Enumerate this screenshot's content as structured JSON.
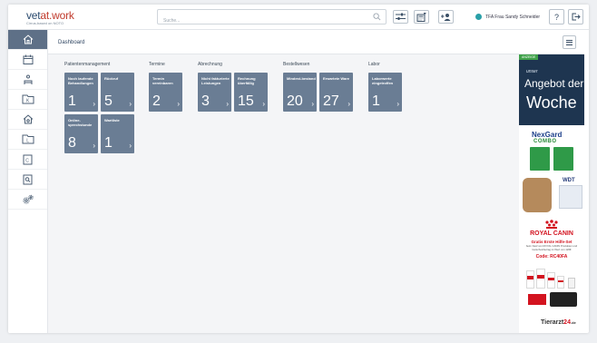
{
  "app": {
    "logo_brand_1": "vet",
    "logo_brand_2": "at.work",
    "logo_tagline": "Cirrus-based on NOTO"
  },
  "search": {
    "placeholder": "Suche..."
  },
  "user": {
    "name": "TFA Frau Sandy Schneider",
    "status_color": "#2aa0a8"
  },
  "header": {
    "title": "Dashboard"
  },
  "sidebar": {
    "items": [
      {
        "icon": "home-icon"
      },
      {
        "icon": "calendar-icon"
      },
      {
        "icon": "waiting-room-icon"
      },
      {
        "icon": "patient-folder-k-icon"
      },
      {
        "icon": "house-visit-icon"
      },
      {
        "icon": "folder-l-icon"
      },
      {
        "icon": "document-c-icon"
      },
      {
        "icon": "document-search-icon"
      },
      {
        "icon": "settings-gears-icon"
      }
    ]
  },
  "groups": [
    {
      "title": "Patientenmanagement",
      "tiles": [
        {
          "label": "Noch laufende Behandlungen",
          "count": "1"
        },
        {
          "label": "Rückruf",
          "count": "5"
        },
        {
          "label": "Online-sprechstunde",
          "count": "8"
        },
        {
          "label": "Wartliste",
          "count": "1"
        }
      ]
    },
    {
      "title": "Termine",
      "tiles": [
        {
          "label": "Termin vereinbaren",
          "count": "2"
        }
      ]
    },
    {
      "title": "Abrechnung",
      "tiles": [
        {
          "label": "Nicht fakturierte Leistungen",
          "count": "3"
        },
        {
          "label": "Rechnung überfällig",
          "count": "15"
        }
      ]
    },
    {
      "title": "Bestellwesen",
      "tiles": [
        {
          "label": "Mindest-bestand",
          "count": "20"
        },
        {
          "label": "Erwartete Ware",
          "count": "27"
        }
      ]
    },
    {
      "title": "Labor",
      "tiles": [
        {
          "label": "Laborwerte eingetroffen",
          "count": "1"
        }
      ]
    }
  ],
  "ads": {
    "ad1": {
      "badge": "ANZEIGE",
      "line1": "unser",
      "line2": "Angebot der",
      "line3": "Woche"
    },
    "nexgard": {
      "brand": "NexGard",
      "sub": "COMBO"
    },
    "wdt": {
      "logo": "WDT"
    },
    "royalcanin": {
      "logo": "ROYAL CANIN",
      "line1": "Gratis Erste Hilfe-Set",
      "line2": "beim Kauf von ROYAL CANIN Produkten und Gutscheinbetrag im Wert von 120€",
      "code": "Code: RC40FA"
    },
    "tierarzt24": {
      "logo_1": "Tierarzt",
      "logo_2": "24",
      "logo_3": ".de"
    }
  },
  "colors": {
    "tile": "#6a7d94",
    "sidebar_active": "#5e7087",
    "ad_navy": "#1e3550",
    "brand_red": "#d3131f"
  }
}
